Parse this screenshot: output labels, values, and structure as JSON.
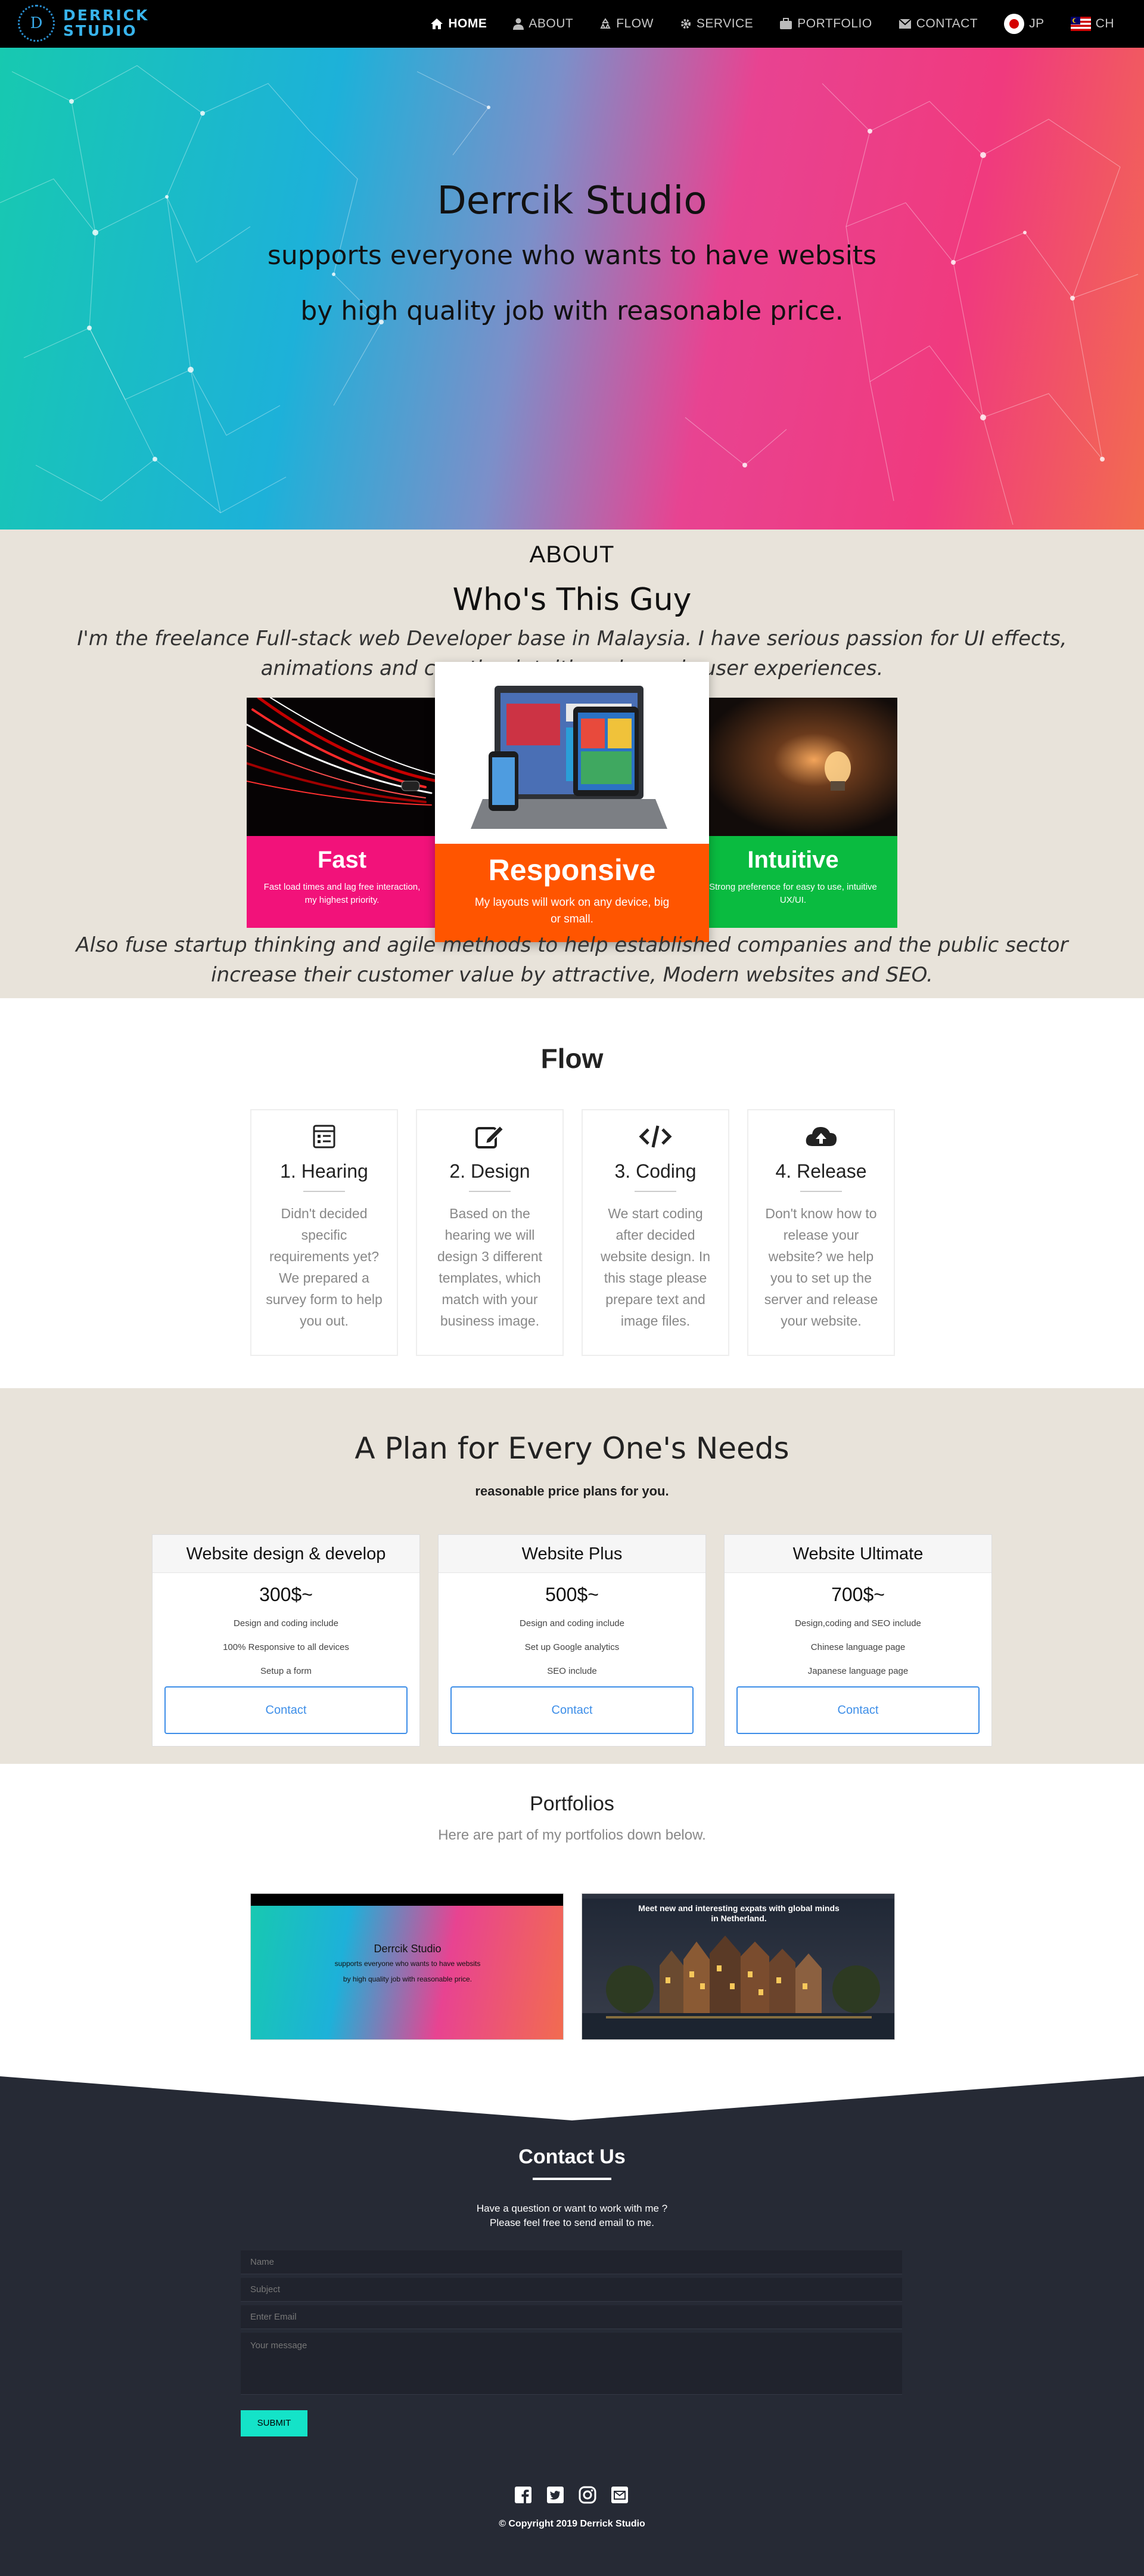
{
  "nav": {
    "logo_letter": "D",
    "logo_line1": "DERRICK",
    "logo_line2": "STUDIO",
    "items": [
      {
        "label": "HOME",
        "icon": "home-icon",
        "active": true
      },
      {
        "label": "ABOUT",
        "icon": "user-icon"
      },
      {
        "label": "FLOW",
        "icon": "recycle-icon"
      },
      {
        "label": "SERVICE",
        "icon": "gear-icon"
      },
      {
        "label": "PORTFOLIO",
        "icon": "briefcase-icon"
      },
      {
        "label": "CONTACT",
        "icon": "envelope-icon"
      }
    ],
    "lang": [
      {
        "label": "JP",
        "icon": "japan-flag-icon"
      },
      {
        "label": "CH",
        "icon": "malaysia-flag-icon"
      }
    ]
  },
  "hero": {
    "title": "Derrcik Studio",
    "line1": "supports everyone who wants to have websits",
    "line2": "by high quality job with reasonable price."
  },
  "about": {
    "label": "ABOUT",
    "title": "Who's This Guy",
    "intro": "I'm the freelance Full-stack web Developer base in Malaysia. I have serious passion for UI effects, animations and creating intuitive, dynamic user experiences.",
    "outro": "Also fuse startup thinking and agile methods to help established companies and the public sector increase their customer value by attractive, Modern websites and SEO.",
    "cards": [
      {
        "title": "Fast",
        "desc": "Fast load times and lag free interaction, my highest priority.",
        "color": "#f2127a"
      },
      {
        "title": "Responsive",
        "desc": "My layouts will work on any device, big or small.",
        "color": "#ff5500"
      },
      {
        "title": "Intuitive",
        "desc": "Strong preference for easy to use, intuitive UX/UI.",
        "color": "#0abb40"
      }
    ]
  },
  "flow": {
    "title": "Flow",
    "steps": [
      {
        "name": "1. Hearing",
        "desc": "Didn't decided specific requirements yet? We prepared a survey form to help you out.",
        "icon": "survey-form-icon"
      },
      {
        "name": "2. Design",
        "desc": "Based on the hearing we will design 3 different templates, which match with your business image.",
        "icon": "edit-icon"
      },
      {
        "name": "3. Coding",
        "desc": "We start coding after decided website design. In this stage please prepare text and image files.",
        "icon": "code-icon"
      },
      {
        "name": "4. Release",
        "desc": "Don't know how to release your website? we help you to set up the server and release your website.",
        "icon": "cloud-upload-icon"
      }
    ]
  },
  "pricing": {
    "title": "A Plan for Every One's Needs",
    "subtitle": "reasonable price plans for you.",
    "plans": [
      {
        "name": "Website design & develop",
        "price": "300$~",
        "features": [
          "Design and coding include",
          "100% Responsive to all devices",
          "Setup a form"
        ],
        "button": "Contact"
      },
      {
        "name": "Website Plus",
        "price": "500$~",
        "features": [
          "Design and coding include",
          "Set up Google analytics",
          "SEO include"
        ],
        "button": "Contact"
      },
      {
        "name": "Website Ultimate",
        "price": "700$~",
        "features": [
          "Design,coding and SEO include",
          "Chinese language page",
          "Japanese language page"
        ],
        "button": "Contact"
      }
    ]
  },
  "portfolio": {
    "title": "Portfolios",
    "subtitle": "Here are part of my portfolios down below.",
    "items": [
      {
        "title": "Derrcik Studio",
        "line1": "supports everyone who wants to have websits",
        "line2": "by high quality job with reasonable price."
      },
      {
        "line1": "Meet new and interesting expats with global minds",
        "line2": "in Netherland."
      }
    ]
  },
  "contact": {
    "title": "Contact Us",
    "text1": "Have a question or want to work with me ?",
    "text2": "Please feel free to send email to me.",
    "fields": {
      "name": "Name",
      "subject": "Subject",
      "email": "Enter Email",
      "message": "Your message"
    },
    "submit": "SUBMIT",
    "social": [
      "facebook-icon",
      "twitter-icon",
      "instagram-icon",
      "mail-icon"
    ],
    "copyright": "© Copyright 2019 Derrick Studio"
  }
}
